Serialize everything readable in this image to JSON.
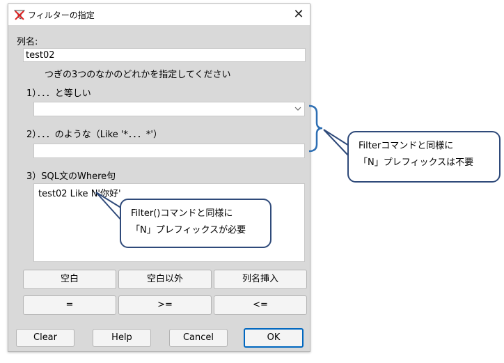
{
  "window": {
    "title": "フィルターの指定",
    "close_glyph": "✕"
  },
  "form": {
    "column_label": "列名:",
    "column_value": "test02",
    "instruction": "つぎの3つのなかのどれかを指定してください",
    "opt1_label": "1）．．．と等しい",
    "opt1_value": "",
    "opt2_label": "2）．．．のような（Like '*．．．*'）",
    "opt2_value": "",
    "opt3_label": "3）SQL文のWhere句",
    "opt3_value": "test02 Like N'你好'"
  },
  "buttons": {
    "row1": [
      "空白",
      "空白以外",
      "列名挿入"
    ],
    "row2": [
      "=",
      ">=",
      "<="
    ],
    "bottom": [
      "Clear",
      "Help",
      "Cancel",
      "OK"
    ]
  },
  "callouts": {
    "right_line1": "Filterコマンドと同様に",
    "right_line2": "「N」プレフィックスは不要",
    "inner_line1": "Filter()コマンドと同様に",
    "inner_line2": "「N」プレフィックスが必要"
  },
  "icons": {
    "app": "filter-app-icon",
    "close": "close-icon",
    "combo": "chevron-down-icon"
  },
  "colors": {
    "callout_border": "#2f4a7a",
    "bracket": "#2e6fb3",
    "ok_border": "#0067c0"
  }
}
